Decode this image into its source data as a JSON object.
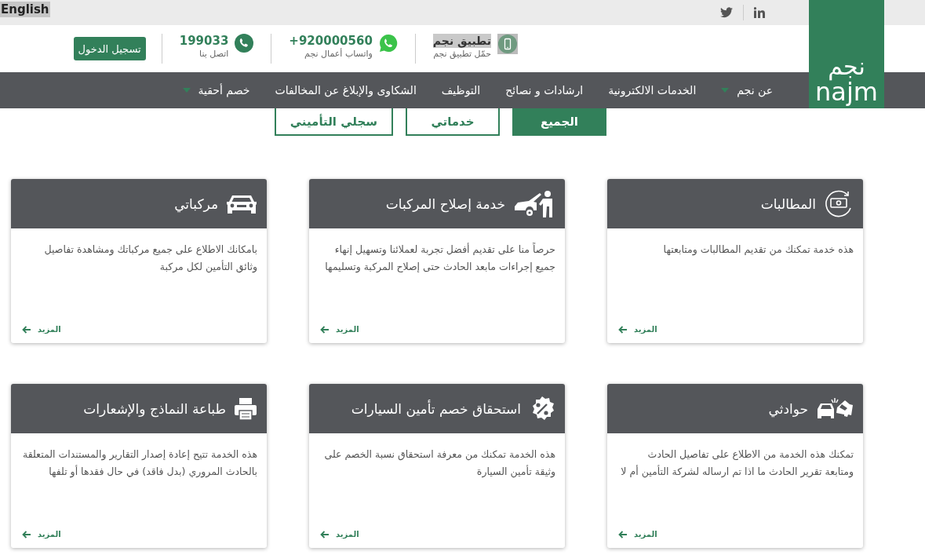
{
  "top_bar": {
    "language_link": "English"
  },
  "logo": {
    "arabic": "نجم",
    "latin": "najm"
  },
  "header": {
    "app": {
      "title": "تطبيق نجم",
      "subtitle": "حمّل تطبيق نجم"
    },
    "whatsapp": {
      "number": "+920000560",
      "label": "واتساب أعمال نجم"
    },
    "phone": {
      "number": "199033",
      "label": "اتصل بنا"
    },
    "login_button": "تسجيل الدخول"
  },
  "nav": [
    {
      "label": "عن نجم",
      "dropdown": true
    },
    {
      "label": "الخدمات الالكترونية",
      "dropdown": false
    },
    {
      "label": "ارشادات و نصائح",
      "dropdown": false
    },
    {
      "label": "التوظيف",
      "dropdown": false
    },
    {
      "label": "الشكاوى والإبلاغ عن المخالفات",
      "dropdown": false
    },
    {
      "label": "خصم أحقية",
      "dropdown": true
    }
  ],
  "filters": [
    {
      "label": "الجميع",
      "selected": true
    },
    {
      "label": "خدماتي",
      "selected": false
    },
    {
      "label": "سجلي التأميني",
      "selected": false
    }
  ],
  "cards": [
    {
      "kind": "claims",
      "title": "المطالبات",
      "description": "هذه خدمة تمكنك من تقديم المطالبات ومتابعتها",
      "more": "المزيد"
    },
    {
      "kind": "repair",
      "title": "خدمة إصلاح المركبات",
      "description": "حرصاً منا على تقديم أفضل تجربة لعملائنا وتسهيل إنهاء جميع إجراءات مابعد الحادث حتى إصلاح المركبة وتسليمها",
      "more": "المزيد"
    },
    {
      "kind": "car",
      "title": "مركباتي",
      "description": "بامكانك الاطلاع على جميع مركباتك ومشاهدة تفاصيل وثائق التأمين لكل مركبة",
      "more": "المزيد"
    },
    {
      "kind": "accident",
      "title": "حوادثي",
      "description": "تمكنك هذه الخدمة من الاطلاع على تفاصيل الحادث ومتابعة تقرير الحادث ما اذا تم ارساله لشركة التأمين أم لا",
      "more": "المزيد"
    },
    {
      "kind": "discount",
      "title": "استحقاق خصم تأمين السيارات",
      "description": "هذه الخدمة تمكنك من معرفة استحقاق نسبة الخصم على وثيقة تأمين السيارة",
      "more": "المزيد"
    },
    {
      "kind": "printer",
      "title": "طباعة النماذج والإشعارات",
      "description": "هذه الخدمة تتيح إعادة إصدار التقارير والمستندات المتعلقة بالحادث المروري (بدل فاقد) في حال فقدها أو تلفها",
      "more": "المزيد"
    }
  ]
}
